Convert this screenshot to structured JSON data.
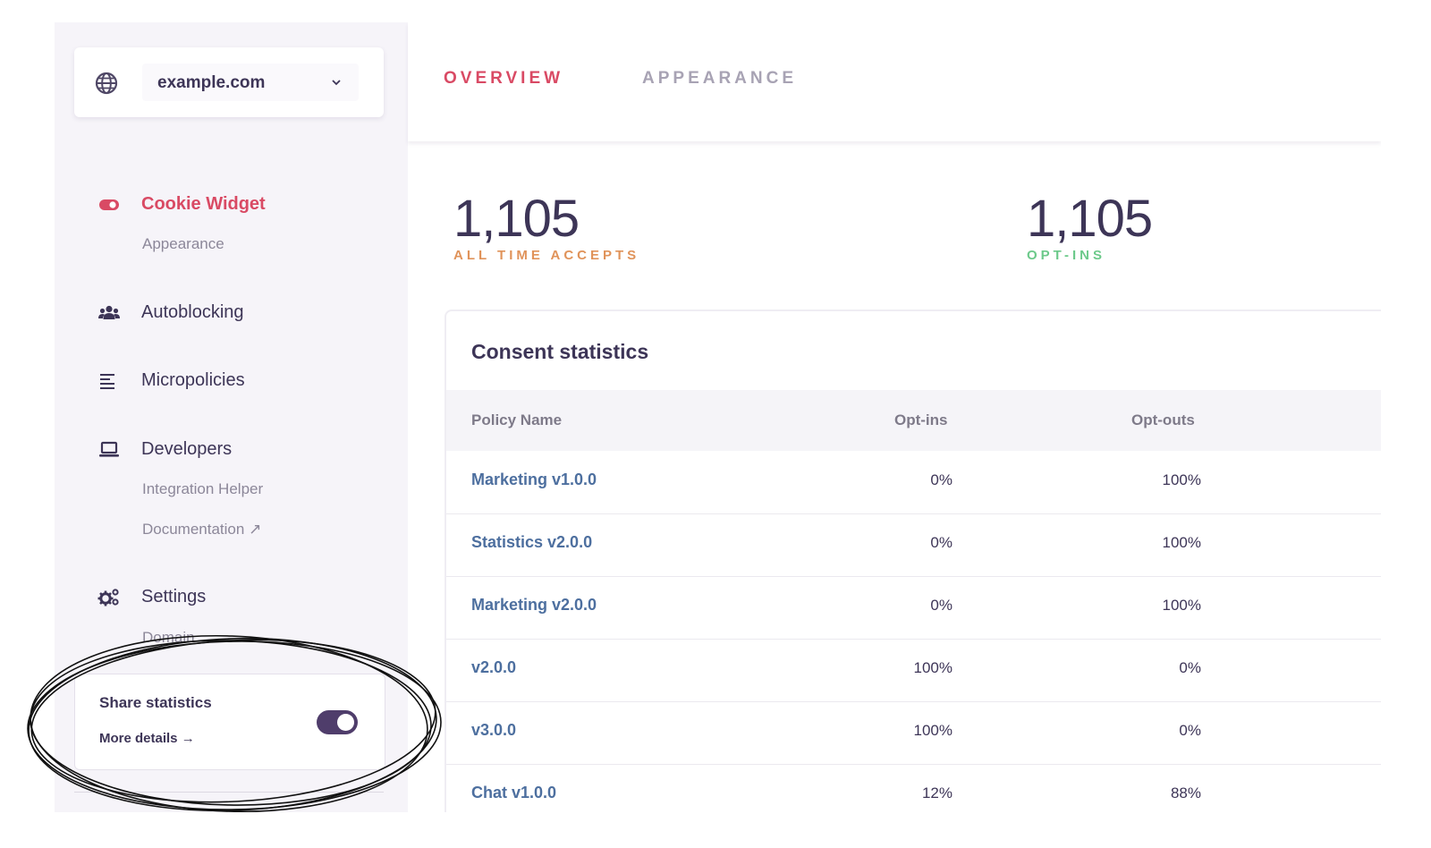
{
  "domain": {
    "name": "example.com"
  },
  "nav": {
    "cookie_widget": {
      "label": "Cookie Widget",
      "sub": [
        "Appearance"
      ]
    },
    "autoblocking": {
      "label": "Autoblocking"
    },
    "micropolicies": {
      "label": "Micropolicies"
    },
    "developers": {
      "label": "Developers",
      "sub": [
        "Integration Helper",
        "Documentation ↗"
      ]
    },
    "settings": {
      "label": "Settings",
      "sub": [
        "Domain"
      ]
    }
  },
  "share": {
    "title": "Share statistics",
    "link": "More details →",
    "enabled": true
  },
  "tabs": {
    "overview": "OVERVIEW",
    "appearance": "APPEARANCE"
  },
  "stats": {
    "accepts": {
      "value": "1,105",
      "label": "ALL TIME ACCEPTS"
    },
    "optins": {
      "value": "1,105",
      "label": "OPT-INS"
    }
  },
  "consent": {
    "title": "Consent statistics",
    "columns": [
      "Policy Name",
      "Opt-ins",
      "Opt-outs"
    ],
    "rows": [
      {
        "name": "Marketing v1.0.0",
        "optins": "0%",
        "optouts": "100%"
      },
      {
        "name": "Statistics v2.0.0",
        "optins": "0%",
        "optouts": "100%"
      },
      {
        "name": "Marketing v2.0.0",
        "optins": "0%",
        "optouts": "100%"
      },
      {
        "name": "v2.0.0",
        "optins": "100%",
        "optouts": "0%"
      },
      {
        "name": "v3.0.0",
        "optins": "100%",
        "optouts": "0%"
      },
      {
        "name": "Chat v1.0.0",
        "optins": "12%",
        "optouts": "88%"
      }
    ]
  },
  "colors": {
    "accent": "#d94a64",
    "accepts_label": "#e0935a",
    "optins_label": "#6cc98a",
    "link": "#4d6f9f",
    "toggle": "#4f3d6b"
  },
  "icons": {
    "domain": "globe-icon",
    "dropdown": "chevron-down-icon",
    "cookie_widget": "toggle-icon",
    "autoblocking": "users-icon",
    "micropolicies": "align-left-icon",
    "developers": "laptop-icon",
    "settings": "gears-icon"
  }
}
